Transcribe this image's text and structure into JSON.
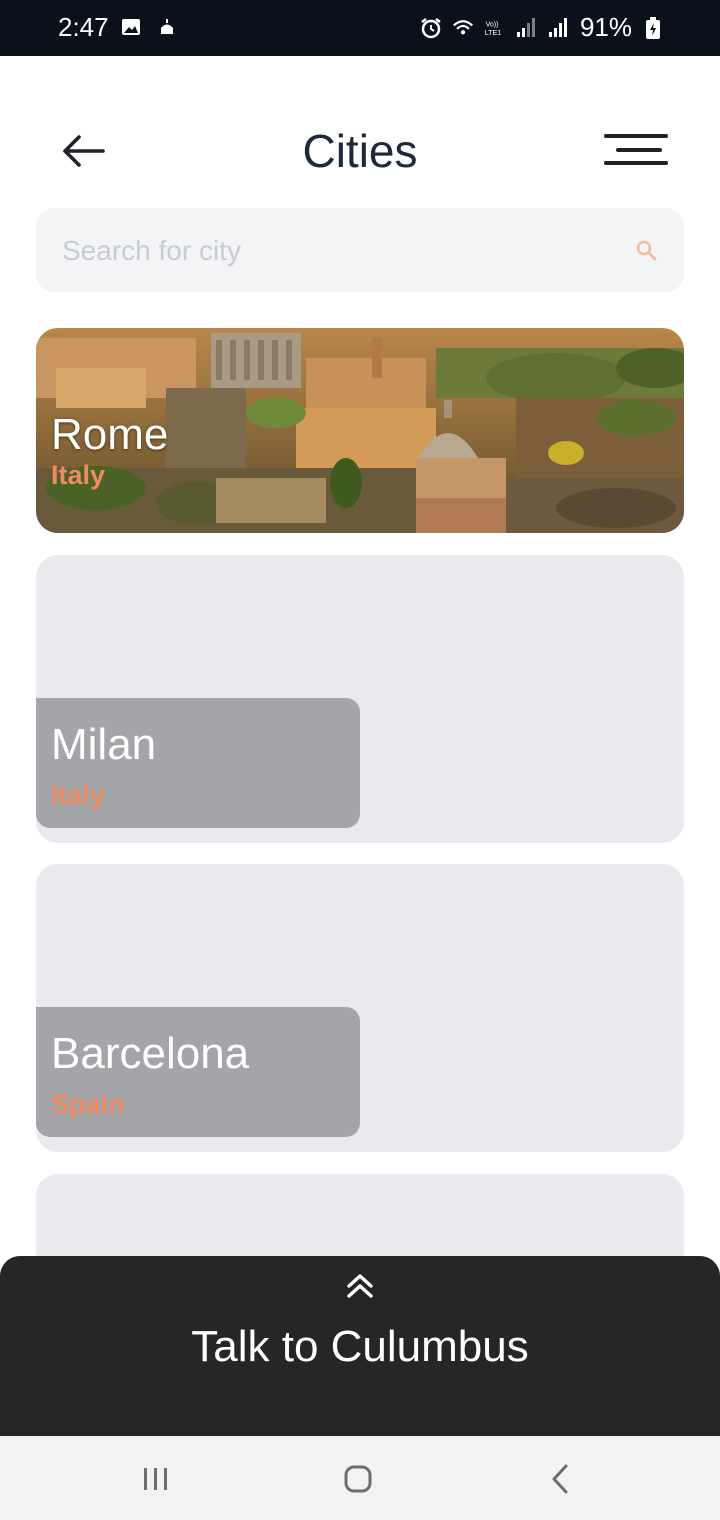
{
  "status_bar": {
    "time": "2:47",
    "battery": "91%",
    "icons": [
      "image-icon",
      "mosque-icon",
      "alarm-icon",
      "wifi-icon",
      "volte-icon",
      "signal-icon",
      "signal-icon",
      "battery-charging-icon"
    ]
  },
  "header": {
    "title": "Cities",
    "back_icon": "arrow-left-icon",
    "menu_icon": "menu-icon"
  },
  "search": {
    "placeholder": "Search for city",
    "value": "",
    "icon": "search-icon"
  },
  "cities": [
    {
      "name": "Rome",
      "country": "Italy",
      "has_image": true
    },
    {
      "name": "Milan",
      "country": "Italy",
      "has_image": false
    },
    {
      "name": "Barcelona",
      "country": "Spain",
      "has_image": false
    }
  ],
  "talk_sheet": {
    "label": "Talk to Culumbus",
    "icon": "double-chevron-up-icon"
  },
  "nav_bar": {
    "buttons": [
      "recent-apps-icon",
      "home-icon",
      "back-icon"
    ]
  },
  "colors": {
    "title": "#1e2a3c",
    "country_accent": "#f08a62",
    "card_bg": "#e8eaed",
    "label_panel": "#a4a5a8",
    "sheet_bg": "#262626",
    "status_bar_bg": "#0b111a"
  }
}
